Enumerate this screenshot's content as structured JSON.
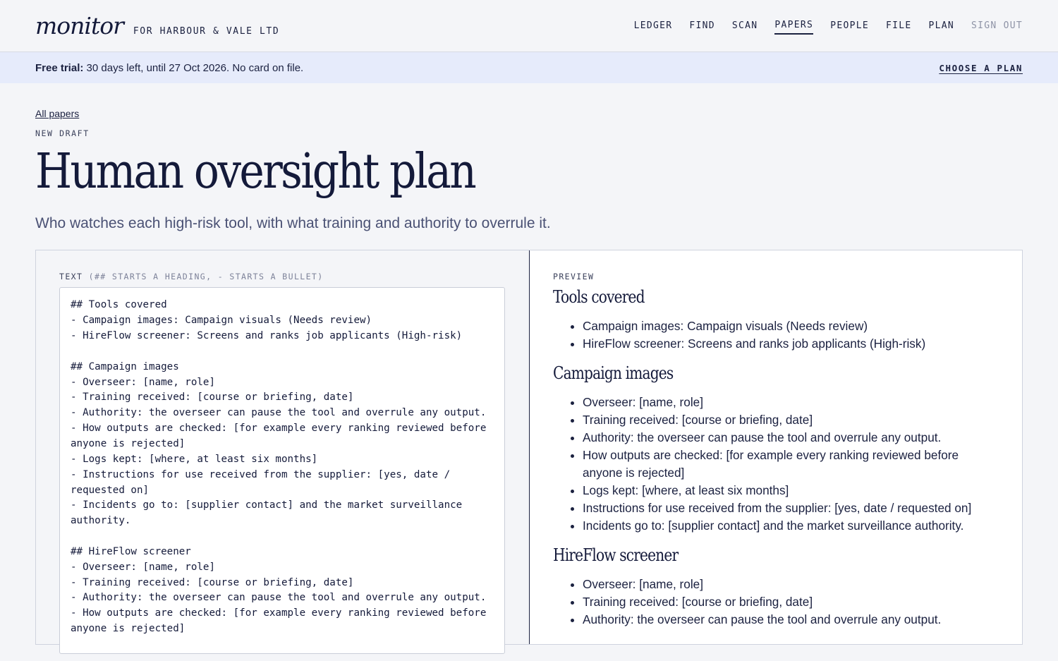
{
  "header": {
    "logo": "monitor",
    "org": "FOR HARBOUR & VALE LTD",
    "nav": [
      {
        "label": "LEDGER"
      },
      {
        "label": "FIND"
      },
      {
        "label": "SCAN"
      },
      {
        "label": "PAPERS",
        "active": true
      },
      {
        "label": "PEOPLE"
      },
      {
        "label": "FILE"
      },
      {
        "label": "PLAN"
      }
    ],
    "sign_out": "SIGN OUT"
  },
  "banner": {
    "strong": "Free trial:",
    "text": " 30 days left, until 27 Oct 2026. No card on file.",
    "action": "CHOOSE A PLAN"
  },
  "page": {
    "back_link": "All papers",
    "kicker": "NEW DRAFT",
    "title": "Human oversight plan",
    "subtitle": "Who watches each high-risk tool, with what training and authority to overrule it."
  },
  "editor": {
    "label": "TEXT",
    "hint": " (## STARTS A HEADING, - STARTS A BULLET)",
    "content": "## Tools covered\n- Campaign images: Campaign visuals (Needs review)\n- HireFlow screener: Screens and ranks job applicants (High-risk)\n\n## Campaign images\n- Overseer: [name, role]\n- Training received: [course or briefing, date]\n- Authority: the overseer can pause the tool and overrule any output.\n- How outputs are checked: [for example every ranking reviewed before anyone is rejected]\n- Logs kept: [where, at least six months]\n- Instructions for use received from the supplier: [yes, date / requested on]\n- Incidents go to: [supplier contact] and the market surveillance authority.\n\n## HireFlow screener\n- Overseer: [name, role]\n- Training received: [course or briefing, date]\n- Authority: the overseer can pause the tool and overrule any output.\n- How outputs are checked: [for example every ranking reviewed before anyone is rejected]"
  },
  "preview": {
    "label": "PREVIEW",
    "sections": [
      {
        "heading": "Tools covered",
        "items": [
          "Campaign images: Campaign visuals (Needs review)",
          "HireFlow screener: Screens and ranks job applicants (High-risk)"
        ]
      },
      {
        "heading": "Campaign images",
        "items": [
          "Overseer: [name, role]",
          "Training received: [course or briefing, date]",
          "Authority: the overseer can pause the tool and overrule any output.",
          "How outputs are checked: [for example every ranking reviewed before anyone is rejected]",
          "Logs kept: [where, at least six months]",
          "Instructions for use received from the supplier: [yes, date / requested on]",
          "Incidents go to: [supplier contact] and the market surveillance authority."
        ]
      },
      {
        "heading": "HireFlow screener",
        "items": [
          "Overseer: [name, role]",
          "Training received: [course or briefing, date]",
          "Authority: the overseer can pause the tool and overrule any output."
        ]
      }
    ]
  }
}
